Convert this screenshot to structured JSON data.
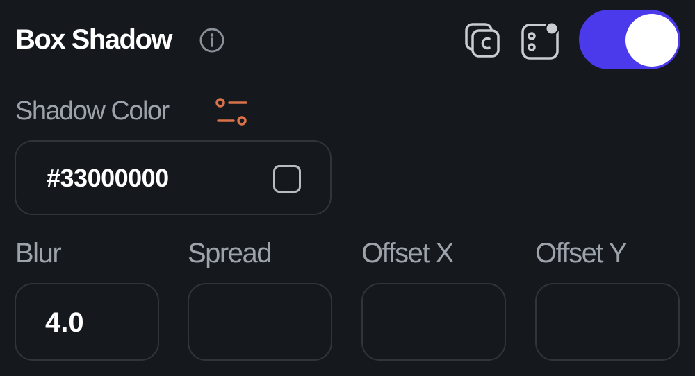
{
  "header": {
    "title": "Box Shadow",
    "info_icon": "info-icon",
    "copy_icon": "copy-icon",
    "variable_icon": "variable-icon",
    "toggle_state": "on"
  },
  "shadow_color": {
    "label": "Shadow Color",
    "settings_icon": "settings-icon",
    "value": "#33000000",
    "swatch_color": "#33000000"
  },
  "fields": [
    {
      "label": "Blur",
      "value": "4.0"
    },
    {
      "label": "Spread",
      "value": ""
    },
    {
      "label": "Offset X",
      "value": ""
    },
    {
      "label": "Offset Y",
      "value": ""
    }
  ],
  "colors": {
    "background": "#15181c",
    "toggle_on": "#4a3aeb",
    "accent_orange": "#d9724a",
    "label_gray": "#9da3ab",
    "border": "#30353c"
  }
}
